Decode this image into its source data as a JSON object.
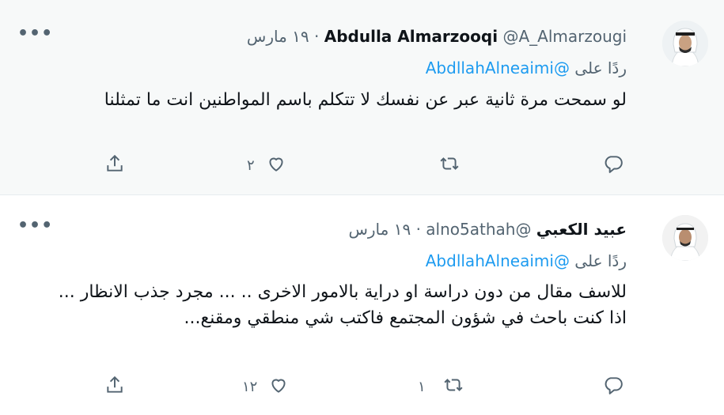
{
  "tweets": [
    {
      "name": "Abdulla Almarzooqi",
      "handle": "@A_Almarzougi",
      "dot": "·",
      "date": "١٩ مارس",
      "more": "•••",
      "reply_prefix": "ردًا على",
      "reply_mention": "@AbdllahAlneaimi",
      "text": "لو سمحت مرة ثانية عبر عن نفسك لا تتكلم باسم المواطنين انت ما تمثلنا",
      "reply_count": "",
      "retweet_count": "",
      "like_count": "٢"
    },
    {
      "name": "عبيد الكعبي",
      "handle": "@alno5athah",
      "dot": "·",
      "date": "١٩ مارس",
      "more": "•••",
      "reply_prefix": "ردًا على",
      "reply_mention": "@AbdllahAlneaimi",
      "text": "للاسف مقال من دون دراسة او دراية بالامور الاخرى .. ... مجرد جذب الانظار ... اذا كنت باحث في شؤون المجتمع فاكتب شي منطقي ومقنع...",
      "reply_count": "",
      "retweet_count": "١",
      "like_count": "١٢"
    }
  ],
  "icons": {
    "reply": "reply-icon",
    "retweet": "retweet-icon",
    "like": "like-icon",
    "share": "share-icon",
    "more": "more-icon"
  },
  "colors": {
    "text": "#0f1419",
    "muted": "#536471",
    "link": "#1d9bf0",
    "hover_bg": "#f7f9f9"
  }
}
